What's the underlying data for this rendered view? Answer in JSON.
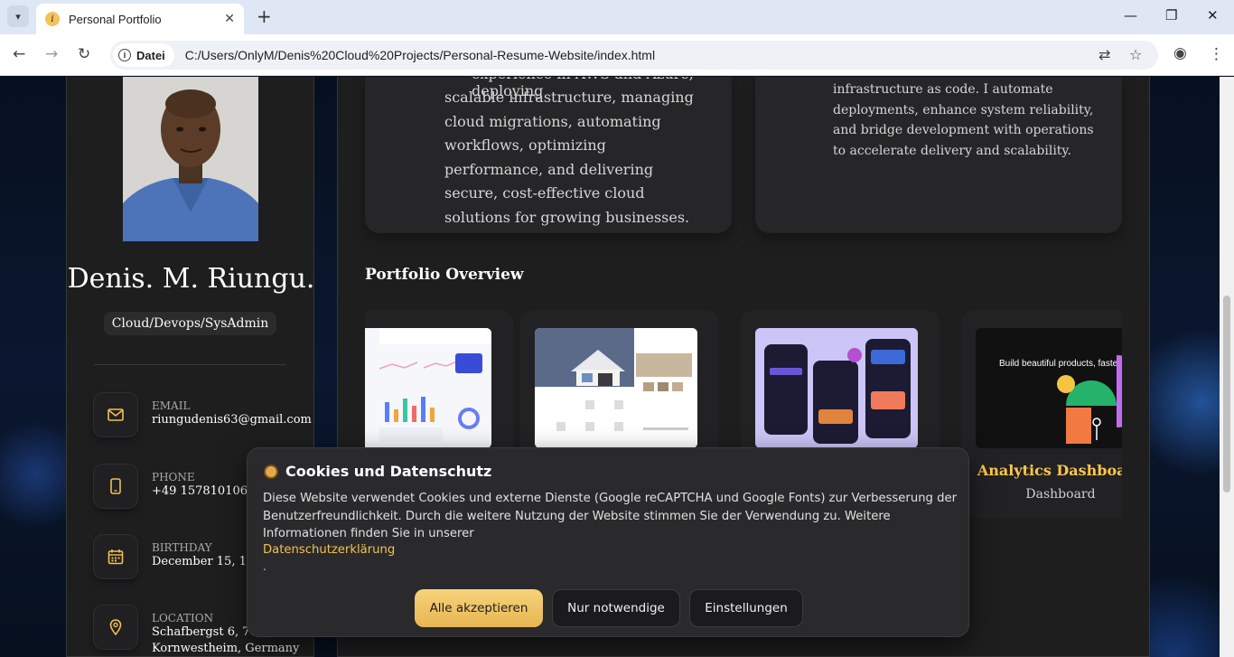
{
  "browser": {
    "tab_title": "Personal Portfolio",
    "tab_favicon": "i",
    "site_chip": "Datei",
    "url": "C:/Users/OnlyM/Denis%20Cloud%20Projects/Personal-Resume-Website/index.html"
  },
  "sidebar": {
    "name": "Denis. M. Riungu.",
    "role": "Cloud/Devops/SysAdmin",
    "contacts": [
      {
        "title": "Email",
        "value": "riungudenis63@gmail.com",
        "icon": "mail-icon"
      },
      {
        "title": "Phone",
        "value": "+49 15781010695",
        "icon": "phone-icon"
      },
      {
        "title": "Birthday",
        "value": "December 15, 1986",
        "icon": "calendar-icon"
      },
      {
        "title": "Location",
        "value": "Schafbergst 6, 70806",
        "value2": "Kornwestheim, Germany",
        "icon": "location-icon"
      }
    ]
  },
  "services": {
    "card1_clipped": "experience in AWS and Azure, deploying",
    "card1_text": "scalable infrastructure, managing cloud migrations, automating workflows, optimizing performance, and delivering secure, cost-effective cloud solutions for growing businesses.",
    "card2_text": "infrastructure as code. I automate deployments, enhance system reliability, and bridge development with operations to accelerate delivery and scalability."
  },
  "portfolio": {
    "title": "Portfolio Overview",
    "projects": [
      {
        "title": "",
        "category": ""
      },
      {
        "title": "",
        "category": ""
      },
      {
        "title": "",
        "category": ""
      },
      {
        "title": "Analytics Dashboard",
        "category": "Dashboard"
      }
    ],
    "thumb4_text": "Build beautiful products, faster."
  },
  "cookie": {
    "title": "Cookies und Datenschutz",
    "text": "Diese Website verwendet Cookies und externe Dienste (Google reCAPTCHA und Google Fonts) zur Verbesserung der Benutzerfreundlichkeit. Durch die weitere Nutzung der Website stimmen Sie der Verwendung zu. Weitere Informationen finden Sie in unserer",
    "link": "Datenschutzerklärung",
    "dot": ".",
    "accept": "Alle akzeptieren",
    "necessary": "Nur notwendige",
    "settings": "Einstellungen"
  },
  "colors": {
    "accent": "#ffc84a",
    "card_bg": "#1e1e1f"
  }
}
